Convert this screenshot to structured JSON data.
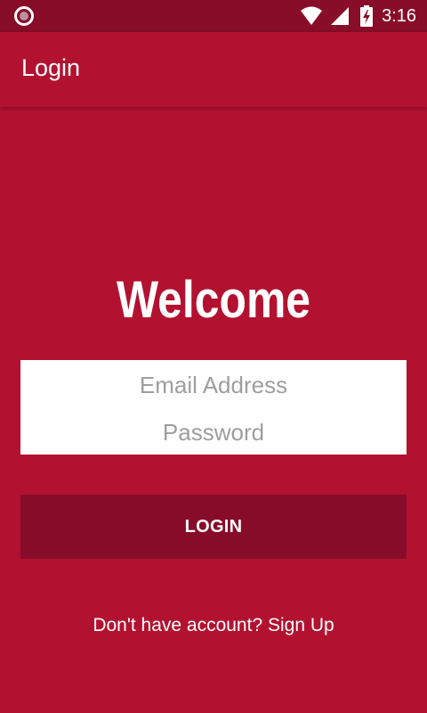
{
  "status_bar": {
    "time": "3:16",
    "icons": [
      "record-icon",
      "wifi-icon",
      "signal-icon",
      "battery-charging-icon"
    ]
  },
  "app_bar": {
    "title": "Login"
  },
  "main": {
    "heading": "Welcome",
    "email_placeholder": "Email Address",
    "password_placeholder": "Password",
    "login_label": "LOGIN",
    "signup_prompt": "Don't have account?",
    "signup_link": "Sign Up"
  },
  "colors": {
    "primary": "#b21230",
    "primary_dark": "#870d28",
    "button": "#860c29",
    "placeholder": "#9e9e9e"
  }
}
